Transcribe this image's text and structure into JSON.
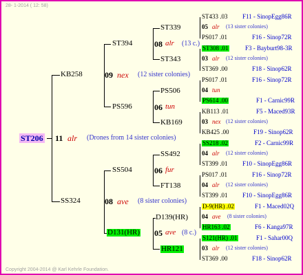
{
  "header": "28- 1-2014 ( 12: 58)",
  "footer": "Copyright 2004-2014 @ Karl Kehrle Foundation.",
  "root": {
    "id": "ST206",
    "num": "11",
    "queen": "alr",
    "note": "(Drones from 14 sister colonies)"
  },
  "gen1": [
    {
      "id": "KB258",
      "num": "09",
      "queen": "nex",
      "note": "(12 sister colonies)"
    },
    {
      "id": "SS324",
      "num": "08",
      "queen": "ave",
      "note": "(8 sister colonies)"
    }
  ],
  "gen2": [
    {
      "id": "ST394",
      "num": "08",
      "queen": "alr",
      "note": "(13 c.)"
    },
    {
      "id": "PS596",
      "num": "06",
      "queen": "tun",
      "note": ""
    },
    {
      "id": "SS504",
      "num": "06",
      "queen": "fur",
      "note": ""
    },
    {
      "id": "D131(HR)",
      "num": "05",
      "queen": "ave",
      "note": "(8 c.)"
    }
  ],
  "gen3": [
    {
      "id": "ST339"
    },
    {
      "id": "ST343"
    },
    {
      "id": "PS506"
    },
    {
      "id": "KB169"
    },
    {
      "id": "SS492"
    },
    {
      "id": "FT138"
    },
    {
      "id": "D139(HR)"
    },
    {
      "id": "HR121"
    }
  ],
  "leaves": [
    {
      "top": "ST433 .03",
      "mid_num": "05",
      "mid_q": "alr",
      "mid_note": "(13 sister colonies)",
      "bot": "PS017 .01",
      "top_r": "F11 - SinopEgg86R",
      "bot_r": "F16 - Sinop72R"
    },
    {
      "top": "ST308 .01",
      "mid_num": "03",
      "mid_q": "alr",
      "mid_note": "(12 sister colonies)",
      "bot": "ST369 .00",
      "top_r": "F3 - Bayburt98-3R",
      "bot_r": "F18 - Sinop62R"
    },
    {
      "top": "PS017 .01",
      "mid_num": "04",
      "mid_q": "tun",
      "mid_note": "",
      "bot": "PS614 .00",
      "top_r": "F16 - Sinop72R",
      "bot_r": "F1 - Carnic99R"
    },
    {
      "top": "KB113 .01",
      "mid_num": "03",
      "mid_q": "nex",
      "mid_note": "(12 sister colonies)",
      "bot": "KB425 .00",
      "top_r": "F5 - Maced93R",
      "bot_r": "F19 - Sinop62R"
    },
    {
      "top": "SS218 .02",
      "mid_num": "04",
      "mid_q": "alr",
      "mid_note": "(12 sister colonies)",
      "bot": "ST399 .01",
      "top_r": "F2 - Carnic99R",
      "bot_r": "F10 - SinopEgg86R"
    },
    {
      "top": "PS017 .01",
      "mid_num": "04",
      "mid_q": "alr",
      "mid_note": "(12 sister colonies)",
      "bot": "ST399 .01",
      "top_r": "F16 - Sinop72R",
      "bot_r": "F10 - SinopEgg86R"
    },
    {
      "top": "D-9(HR) .02",
      "mid_num": "04",
      "mid_q": "ave",
      "mid_note": "(8 sister colonies)",
      "bot": "HR163 .02",
      "top_r": "F1 - Maced02Q",
      "bot_r": "F6 - Kanga97R"
    },
    {
      "top": "S121(HR) .01",
      "mid_num": "03",
      "mid_q": "alr",
      "mid_note": "(12 sister colonies)",
      "bot": "ST369 .00",
      "top_r": "F1 - Sahar00Q",
      "bot_r": "F18 - Sinop62R"
    }
  ],
  "colors": {
    "frame": "#e000b0",
    "background": "#ffffe8",
    "highlight_green": "#00ee00",
    "highlight_yellow": "#ffff00",
    "root_bg": "#f4b8f4",
    "queen": "#cc0000",
    "note": "#3333cc"
  }
}
